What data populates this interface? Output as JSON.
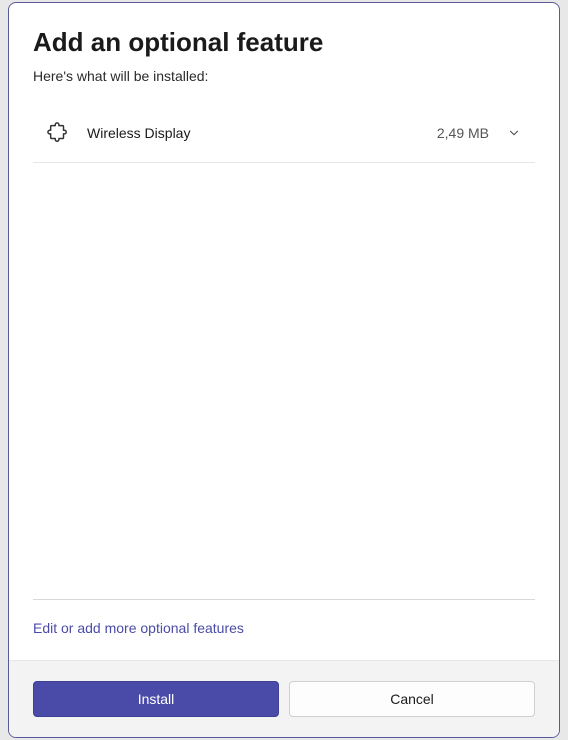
{
  "dialog": {
    "title": "Add an optional feature",
    "subtitle": "Here's what will be installed:",
    "features": [
      {
        "icon": "puzzle-piece",
        "name": "Wireless Display",
        "size": "2,49 MB"
      }
    ],
    "editLink": "Edit or add more optional features",
    "buttons": {
      "install": "Install",
      "cancel": "Cancel"
    }
  },
  "colors": {
    "accent": "#4a4ba8"
  }
}
